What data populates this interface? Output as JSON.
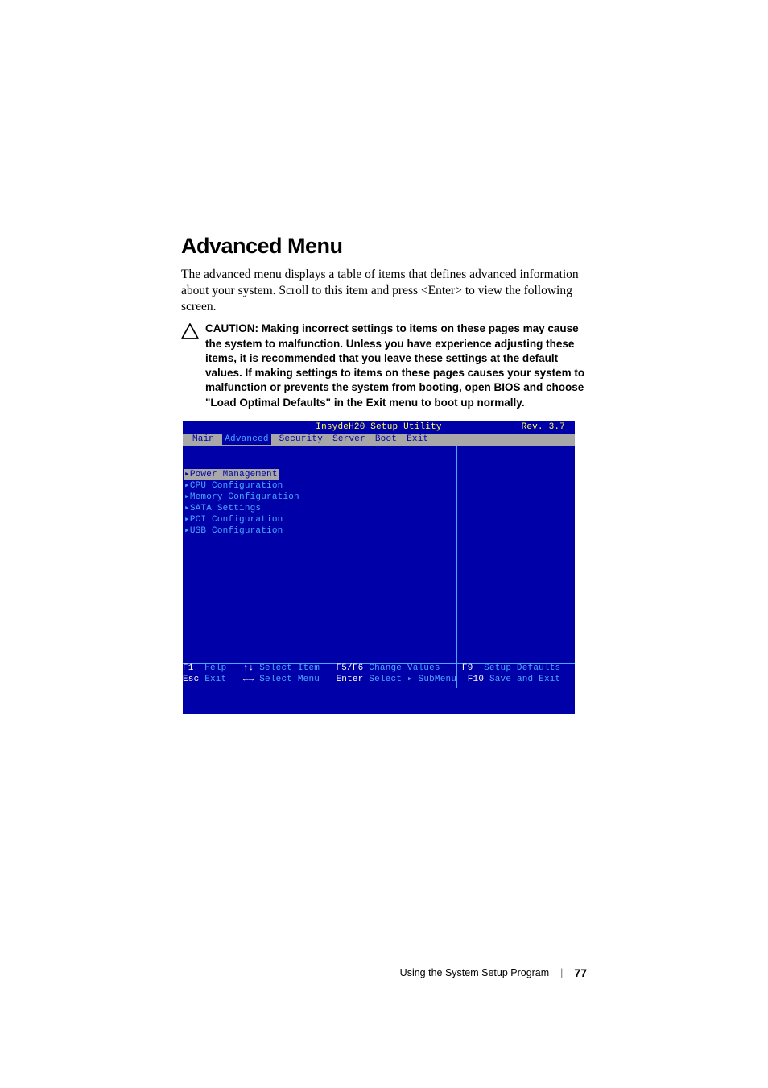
{
  "heading": "Advanced Menu",
  "intro": "The advanced menu displays a table of items that defines advanced information about your system. Scroll to this item and press <Enter> to view the following screen.",
  "caution_label": "CAUTION: ",
  "caution_text": "Making incorrect settings to items on these pages may cause the system to malfunction. Unless you have experience adjusting these items, it is recommended that you leave these settings at the default values. If making settings to items on these pages causes your system to malfunction or prevents the system from booting, open BIOS and choose \"Load Optimal Defaults\" in the Exit menu to boot up normally.",
  "bios": {
    "title": "InsydeH20 Setup Utility",
    "rev": "Rev. 3.7",
    "tabs": [
      "Main",
      "Advanced",
      "Security",
      "Server",
      "Boot",
      "Exit"
    ],
    "active_tab_index": 1,
    "menu": [
      "▸Power Management",
      "▸CPU Configuration",
      "▸Memory Configuration",
      "▸SATA Settings",
      "▸PCI Configuration",
      "▸USB Configuration"
    ],
    "selected_index": 0,
    "help": {
      "r1k1": "F1",
      "r1l1": "  Help   ",
      "r1k2": "↑↓",
      "r1l2": " Select Item   ",
      "r1k3": "F5/F6",
      "r1l3": " Change Values    ",
      "r1k4": "F9",
      "r1l4": "  Setup Defaults",
      "r2k1": "Esc",
      "r2l1": " Exit   ",
      "r2k2": "←→",
      "r2l2": " Select Menu   ",
      "r2k3": "Enter",
      "r2l3": " Select ▸ SubMenu  ",
      "r2k4": "F10",
      "r2l4": " Save and Exit"
    }
  },
  "footer": {
    "section": "Using the System Setup Program",
    "page": "77"
  }
}
